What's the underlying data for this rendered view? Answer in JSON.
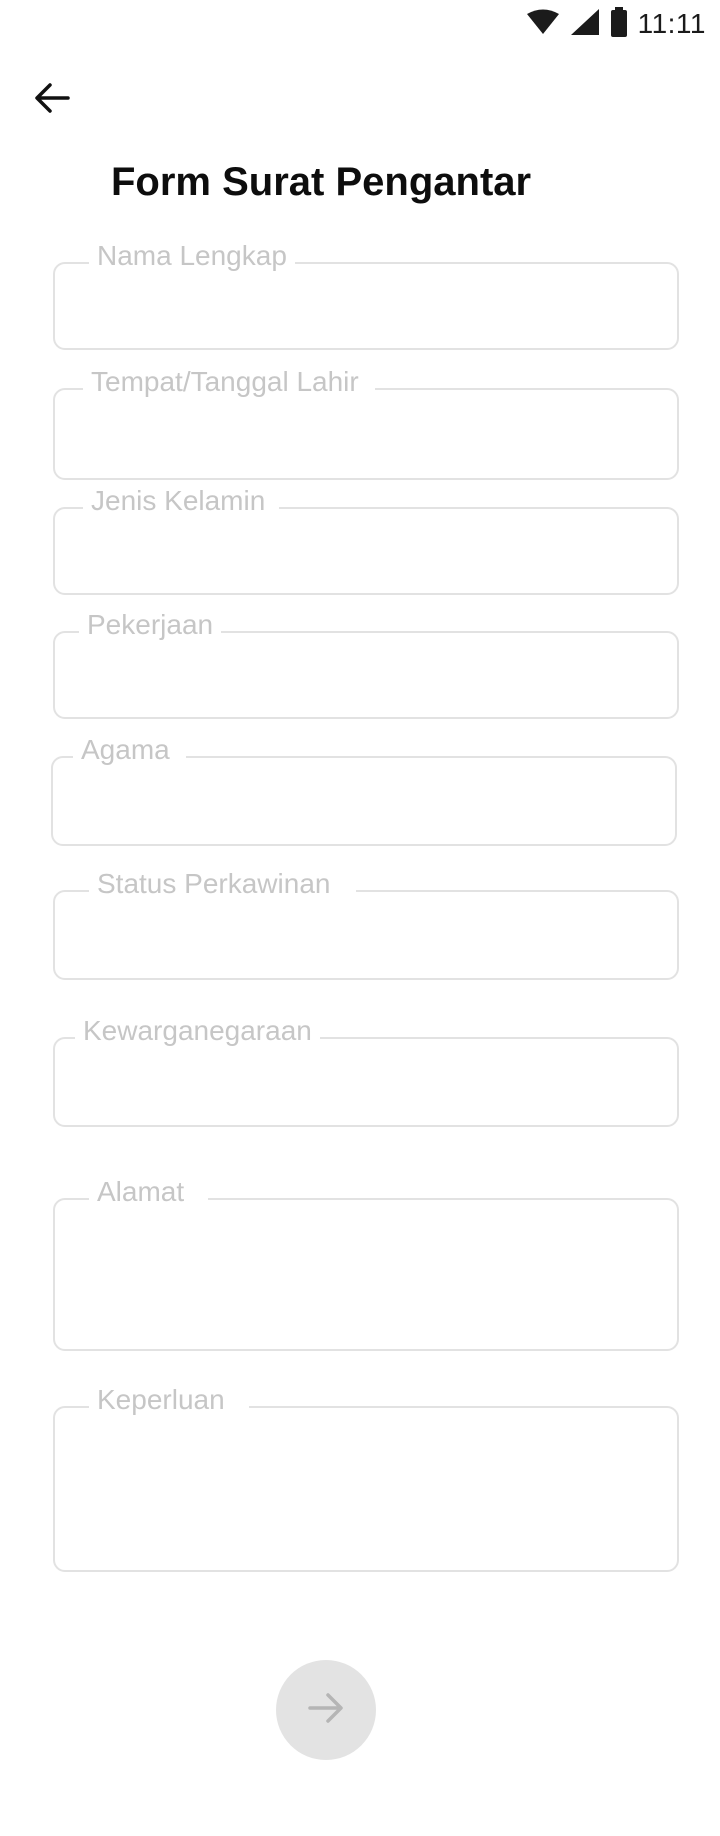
{
  "status_bar": {
    "time": "11:11",
    "icons": [
      "wifi-icon",
      "signal-icon",
      "battery-icon"
    ]
  },
  "header": {
    "back_icon": "arrow-left-icon",
    "title": "Form Surat Pengantar"
  },
  "form": {
    "fields": [
      {
        "label": "Nama Lengkap",
        "value": ""
      },
      {
        "label": "Tempat/Tanggal Lahir",
        "value": ""
      },
      {
        "label": "Jenis Kelamin",
        "value": ""
      },
      {
        "label": "Pekerjaan",
        "value": ""
      },
      {
        "label": "Agama",
        "value": ""
      },
      {
        "label": "Status Perkawinan",
        "value": ""
      },
      {
        "label": "Kewarganegaraan",
        "value": ""
      },
      {
        "label": "Alamat",
        "value": ""
      },
      {
        "label": "Keperluan",
        "value": ""
      }
    ]
  },
  "actions": {
    "next_icon": "arrow-right-icon"
  },
  "colors": {
    "border": "#e2e2e2",
    "label": "#c6c6c6",
    "title": "#0d0d0d",
    "next_button_bg": "#e3e3e3",
    "next_button_icon": "#b5b5b5"
  }
}
